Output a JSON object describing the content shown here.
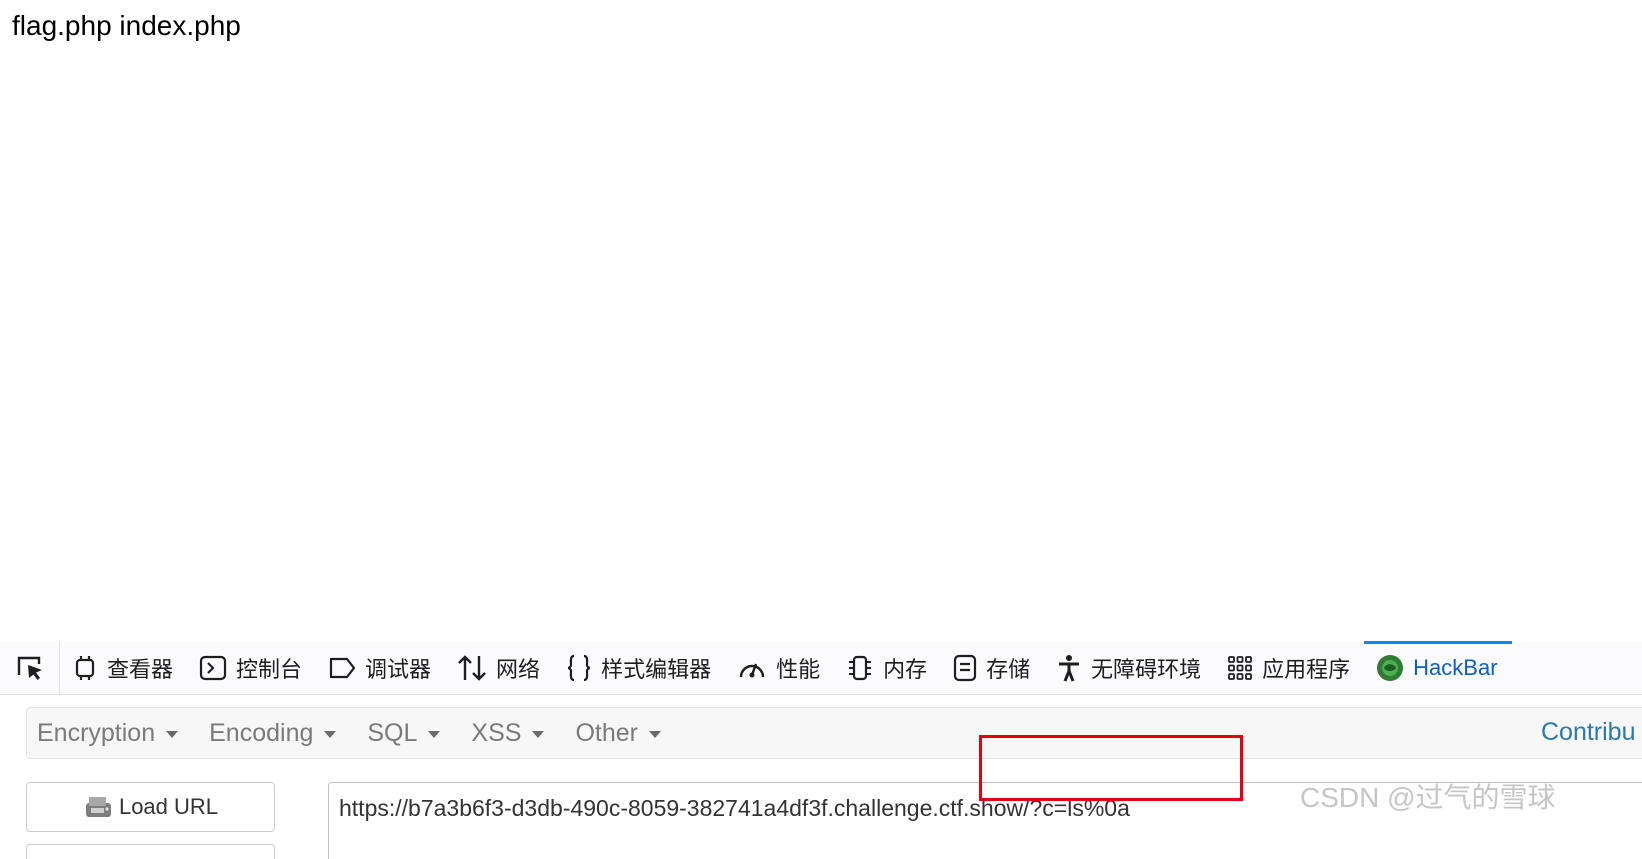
{
  "page": {
    "output_text": "flag.php index.php"
  },
  "devtools": {
    "tabs": [
      {
        "label": "查看器",
        "icon": "inspector-icon"
      },
      {
        "label": "控制台",
        "icon": "console-icon"
      },
      {
        "label": "调试器",
        "icon": "debugger-icon"
      },
      {
        "label": "网络",
        "icon": "network-icon"
      },
      {
        "label": "样式编辑器",
        "icon": "style-editor-icon"
      },
      {
        "label": "性能",
        "icon": "performance-icon"
      },
      {
        "label": "内存",
        "icon": "memory-icon"
      },
      {
        "label": "存储",
        "icon": "storage-icon"
      },
      {
        "label": "无障碍环境",
        "icon": "accessibility-icon"
      },
      {
        "label": "应用程序",
        "icon": "application-icon"
      },
      {
        "label": "HackBar",
        "icon": "hackbar-icon",
        "active": true
      }
    ],
    "accent_color": "#0a84ff"
  },
  "hackbar": {
    "menus": [
      {
        "label": "Encryption"
      },
      {
        "label": "Encoding"
      },
      {
        "label": "SQL"
      },
      {
        "label": "XSS"
      },
      {
        "label": "Other"
      }
    ],
    "contribute_label": "Contribu",
    "load_url_label": "Load URL",
    "url_value": "https://b7a3b6f3-d3db-490c-8059-382741a4df3f.challenge.ctf.show/?c=ls%0a",
    "highlight_color": "#e60012"
  },
  "watermark": {
    "text": "CSDN @过气的雪球"
  }
}
